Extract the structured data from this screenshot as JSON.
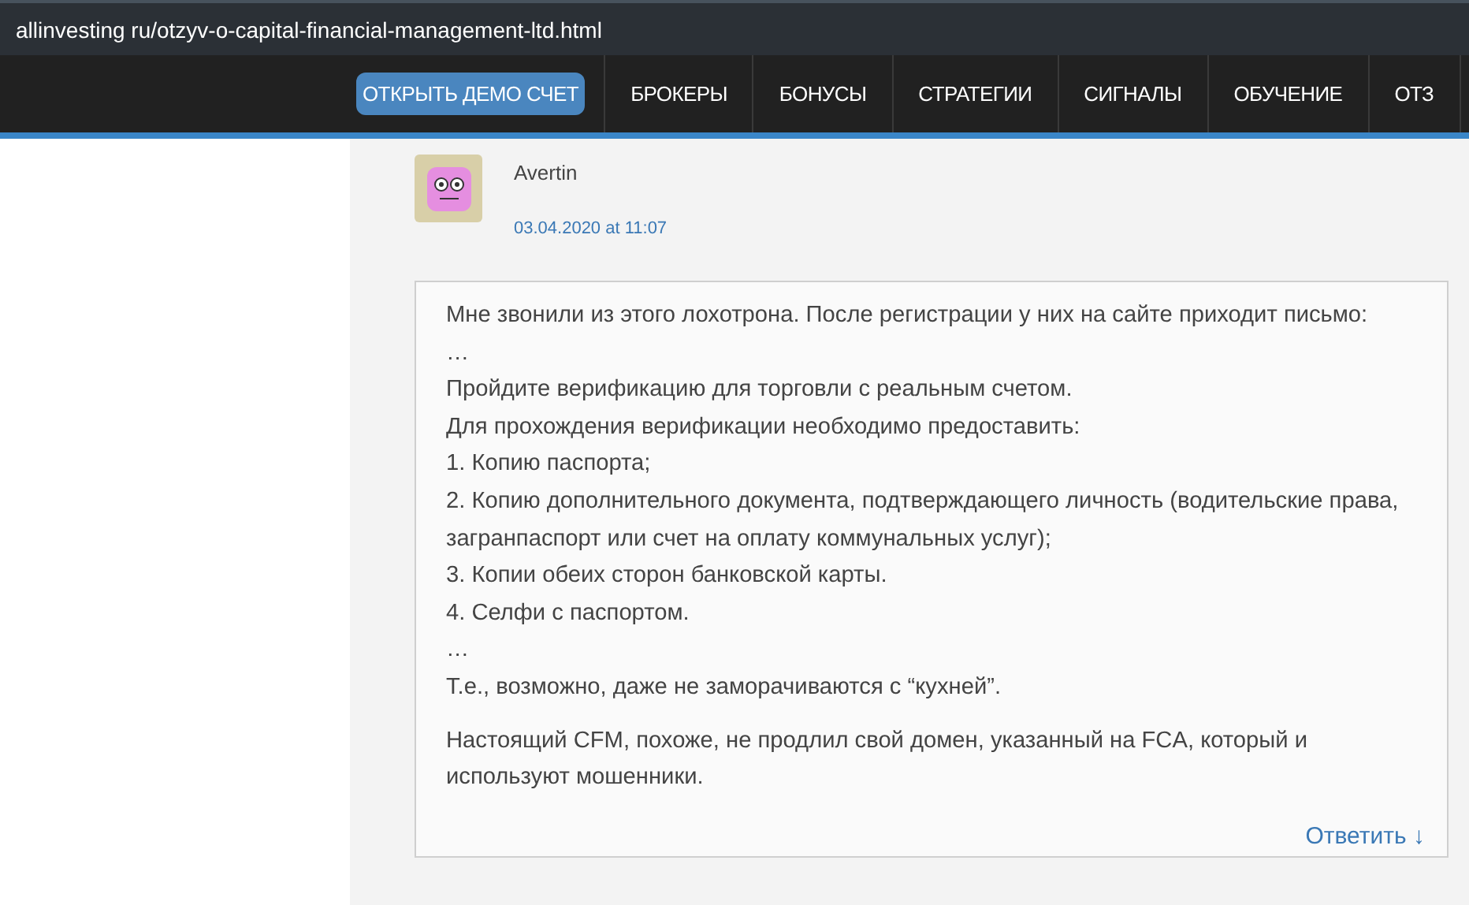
{
  "address_bar": {
    "url": "allinvesting ru/otzyv-o-capital-financial-management-ltd.html"
  },
  "nav": {
    "items": [
      {
        "label": "ОТКРЫТЬ ДЕМО СЧЕТ",
        "selected": true
      },
      {
        "label": "БРОКЕРЫ",
        "selected": false
      },
      {
        "label": "БОНУСЫ",
        "selected": false
      },
      {
        "label": "СТРАТЕГИИ",
        "selected": false
      },
      {
        "label": "СИГНАЛЫ",
        "selected": false
      },
      {
        "label": "ОБУЧЕНИЕ",
        "selected": false
      },
      {
        "label": "ОТЗ",
        "selected": false
      }
    ]
  },
  "comment": {
    "author": "Avertin",
    "date": "03.04.2020 at 11:07",
    "paragraphs": [
      [
        "Мне звонили из этого лохотрона. После регистрации у них на сайте приходит письмо:",
        "…",
        "Пройдите верификацию для торговли с реальным счетом.",
        "Для прохождения верификации необходимо предоставить:",
        "1. Копию паспорта;",
        "2. Копию дополнительного документа, подтверждающего личность (водительские права, загранпаспорт или счет на оплату коммунальных услуг);",
        "3. Копии обеих сторон банковской карты.",
        "4. Селфи с паспортом.",
        "…",
        "Т.е., возможно, даже не заморачиваются с “кухней”."
      ],
      [
        "Настоящий CFM, похоже, не продлил свой домен, указанный на FCA, который и используют мошенники."
      ]
    ],
    "reply_link": "Ответить ↓"
  }
}
